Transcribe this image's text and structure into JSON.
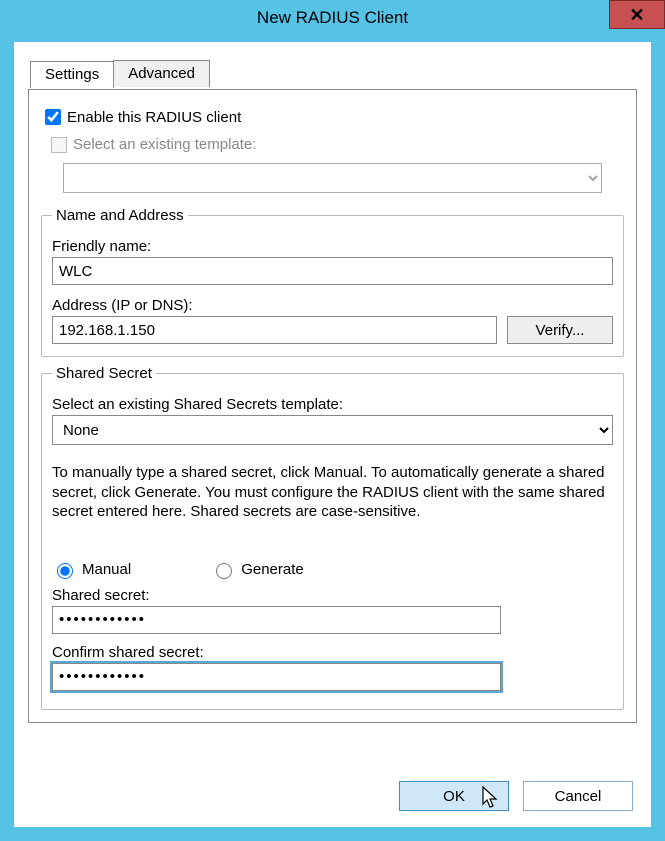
{
  "window": {
    "title": "New RADIUS Client",
    "close_glyph": "✕"
  },
  "tabs": {
    "settings": "Settings",
    "advanced": "Advanced"
  },
  "enable": {
    "label": "Enable this RADIUS client",
    "checked": true
  },
  "template_select": {
    "label": "Select an existing template:",
    "value": ""
  },
  "name_address": {
    "legend": "Name and Address",
    "friendly_label": "Friendly name:",
    "friendly_value": "WLC",
    "address_label": "Address (IP or DNS):",
    "address_value": "192.168.1.150",
    "verify_label": "Verify..."
  },
  "shared_secret": {
    "legend": "Shared Secret",
    "template_label": "Select an existing Shared Secrets template:",
    "template_value": "None",
    "info": "To manually type a shared secret, click Manual. To automatically generate a shared secret, click Generate. You must configure the RADIUS client with the same shared secret entered here. Shared secrets are case-sensitive.",
    "manual_label": "Manual",
    "generate_label": "Generate",
    "mode": "manual",
    "secret_label": "Shared secret:",
    "secret_value": "••••••••••••",
    "confirm_label": "Confirm shared secret:",
    "confirm_value": "••••••••••••"
  },
  "buttons": {
    "ok": "OK",
    "cancel": "Cancel"
  }
}
